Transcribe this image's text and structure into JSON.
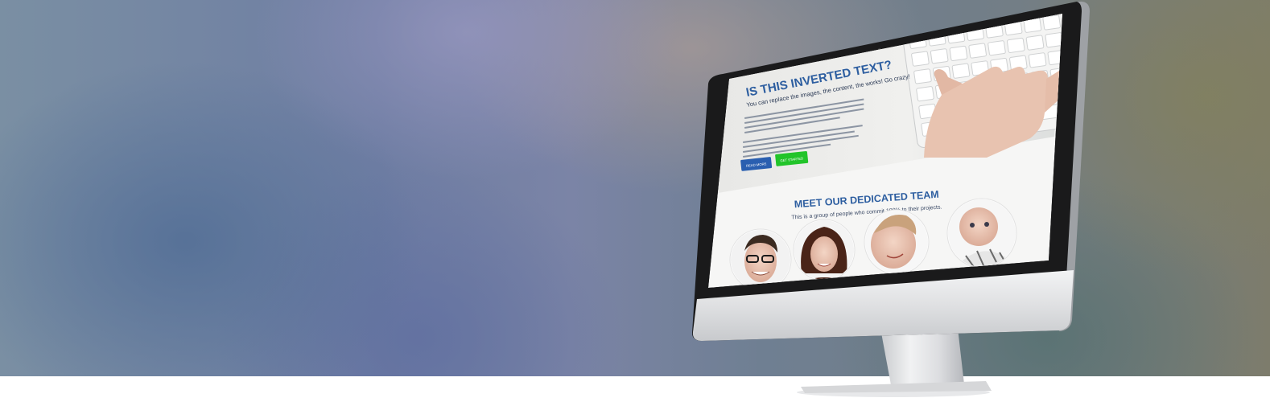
{
  "hero": {
    "colors": {
      "left_blue": "#5a7396",
      "violet": "#8f8fb5",
      "warm_top": "#a89890",
      "olive_right": "#847f62"
    }
  },
  "imac_screen": {
    "hero_section": {
      "heading": "IS THIS INVERTED TEXT?",
      "subheading": "You can replace the images, the content, the works! Go crazy!",
      "read_more_label": "READ MORE",
      "get_started_label": "GET STARTED",
      "read_more_color": "#2a5fb0",
      "get_started_color": "#22c42a"
    },
    "team_section": {
      "title": "MEET OUR DEDICATED TEAM",
      "subtitle": "This is a group of people who commit 100% to their projects.",
      "members": [
        {
          "name": "team-member-man-glasses"
        },
        {
          "name": "team-member-woman"
        },
        {
          "name": "team-member-child"
        },
        {
          "name": "team-member-baby"
        }
      ]
    }
  },
  "device": {
    "icon": "imac-icon",
    "bezel_color": "#141414",
    "body_color": "#d7d8da"
  }
}
